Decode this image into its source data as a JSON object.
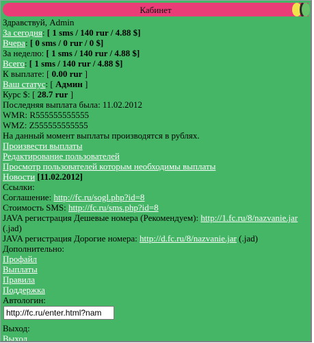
{
  "header": {
    "title": "Кабинет"
  },
  "greeting": "Здравствуй, Admin",
  "stats": {
    "today_label": "За сегодня",
    "today_value": "[ 1 sms / 140 rur / 4.88 $]",
    "yesterday_label": "Вчера",
    "yesterday_value": "[ 0 sms / 0 rur / 0 $]",
    "week_label": "За неделю:",
    "week_value": "[ 1 sms / 140 rur / 4.88 $]",
    "total_label": "Всего",
    "total_value": "[ 1 sms / 140 rur / 4.88 $]",
    "payout_label": "К выплате: [",
    "payout_value": "0.00 rur",
    "payout_end": "]",
    "status_label": "Ваш статус",
    "status_value_pre": ": [",
    "status_value": "Админ",
    "status_end": "]",
    "rate_label": "Курс $: [",
    "rate_value": "28.7 rur",
    "rate_end": "]",
    "last_payout": "Последняя выплата была: 11.02.2012",
    "wmr": "WMR: R555555555555",
    "wmz": "WMZ: Z555555555555",
    "notice": "На данный момент выплаты производятся в рублях."
  },
  "admin_links": {
    "make_payout": "Произвести выплаты",
    "edit_users": "Редактирование пользователей",
    "view_payout_users": "Просмотр пользователей которым необходимы выплаты",
    "news_label": "Новости",
    "news_date": "[11.02.2012]"
  },
  "links": {
    "heading": "Ссылки:",
    "agreement_label": "Соглашение:",
    "agreement_url": "http://fc.ru/sogl.php?id=8",
    "sms_cost_label": "Стоимость SMS:",
    "sms_cost_url": "http://fc.ru/sms.php?id=8",
    "java_cheap_label": "JAVA регистрация Дешевые номера (Рекомендуем):",
    "java_cheap_url": "http://1.fc.ru/8/nazvanie.jar",
    "java_cheap_suffix": "(.jad)",
    "java_exp_label": "JAVA регистрация Дорогие номера:",
    "java_exp_url": "http://d.fc.ru/8/nazvanie.jar",
    "java_exp_suffix": "(.jad)"
  },
  "extra": {
    "heading": "Дополнительно:",
    "profile": "Профайл",
    "payouts": "Выплаты",
    "rules": "Правила",
    "support": "Поддержка"
  },
  "autologin": {
    "label": "Автологин:",
    "value": "http://fc.ru/enter.html?nam"
  },
  "logout": {
    "label": "Выход:",
    "link": "Выход"
  }
}
